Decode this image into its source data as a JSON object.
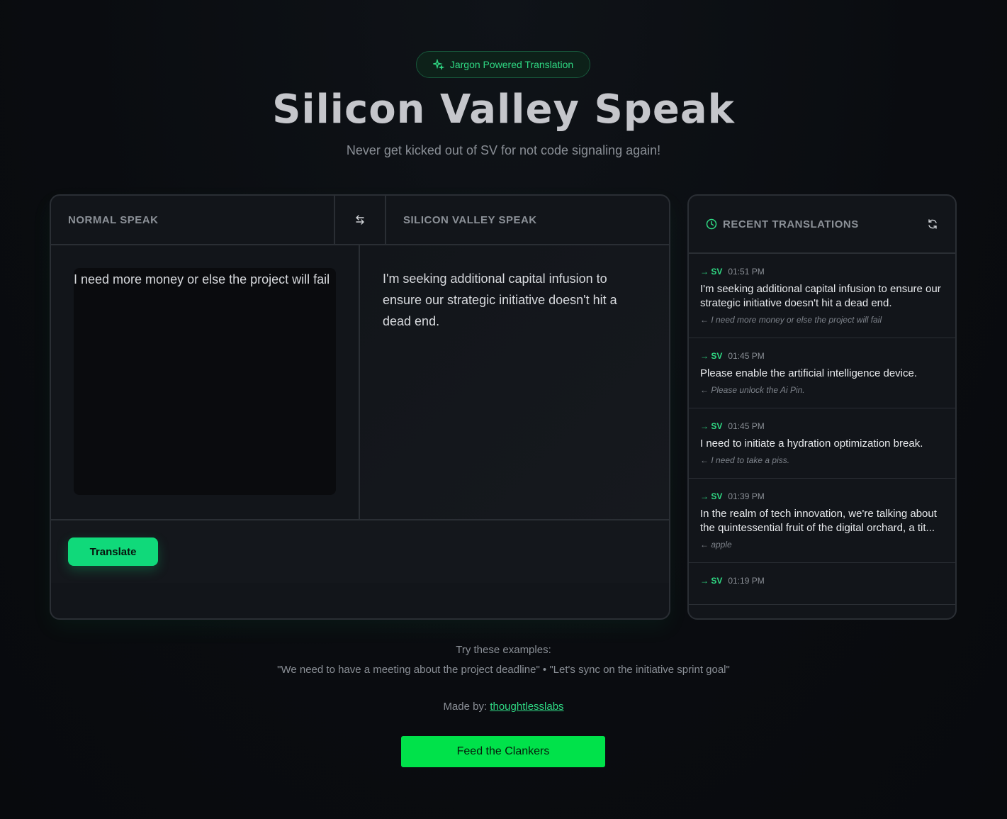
{
  "badge": {
    "icon": "sparkles-icon",
    "label": "Jargon Powered Translation"
  },
  "header": {
    "title": "Silicon Valley Speak",
    "subtitle": "Never get kicked out of SV for not code signaling again!"
  },
  "translator": {
    "source_label": "NORMAL SPEAK",
    "target_label": "SILICON VALLEY SPEAK",
    "swap_icon": "swap-arrows-icon",
    "input_value": "I need more money or else the project will fail",
    "output_text": "I'm seeking additional capital infusion to ensure our strategic initiative doesn't hit a dead end.",
    "translate_label": "Translate"
  },
  "recent": {
    "title": "RECENT TRANSLATIONS",
    "clock_icon": "clock-icon",
    "refresh_icon": "refresh-icon",
    "items": [
      {
        "tag": "→ SV",
        "time": "01:51 PM",
        "text": "I'm seeking additional capital infusion to ensure our strategic initiative doesn't hit a dead end.",
        "source": "← I need more money or else the project will fail"
      },
      {
        "tag": "→ SV",
        "time": "01:45 PM",
        "text": "Please enable the artificial intelligence device.",
        "source": "← Please unlock the Ai Pin."
      },
      {
        "tag": "→ SV",
        "time": "01:45 PM",
        "text": "I need to initiate a hydration optimization break.",
        "source": "← I need to take a piss."
      },
      {
        "tag": "→ SV",
        "time": "01:39 PM",
        "text": "In the realm of tech innovation, we're talking about the quintessential fruit of the digital orchard, a tit...",
        "source": "← apple"
      },
      {
        "tag": "→ SV",
        "time": "01:19 PM",
        "text": "",
        "source": ""
      }
    ]
  },
  "footer": {
    "examples_label": "Try these examples:",
    "examples": "\"We need to have a meeting about the project deadline\" • \"Let's sync on the initiative sprint goal\"",
    "made_by_label": "Made by:",
    "made_by_link": "thoughtlesslabs",
    "feed_button": "Feed the Clankers"
  },
  "colors": {
    "accent": "#10d97a",
    "feed_button": "#00e24a",
    "background": "#0a0c10"
  }
}
